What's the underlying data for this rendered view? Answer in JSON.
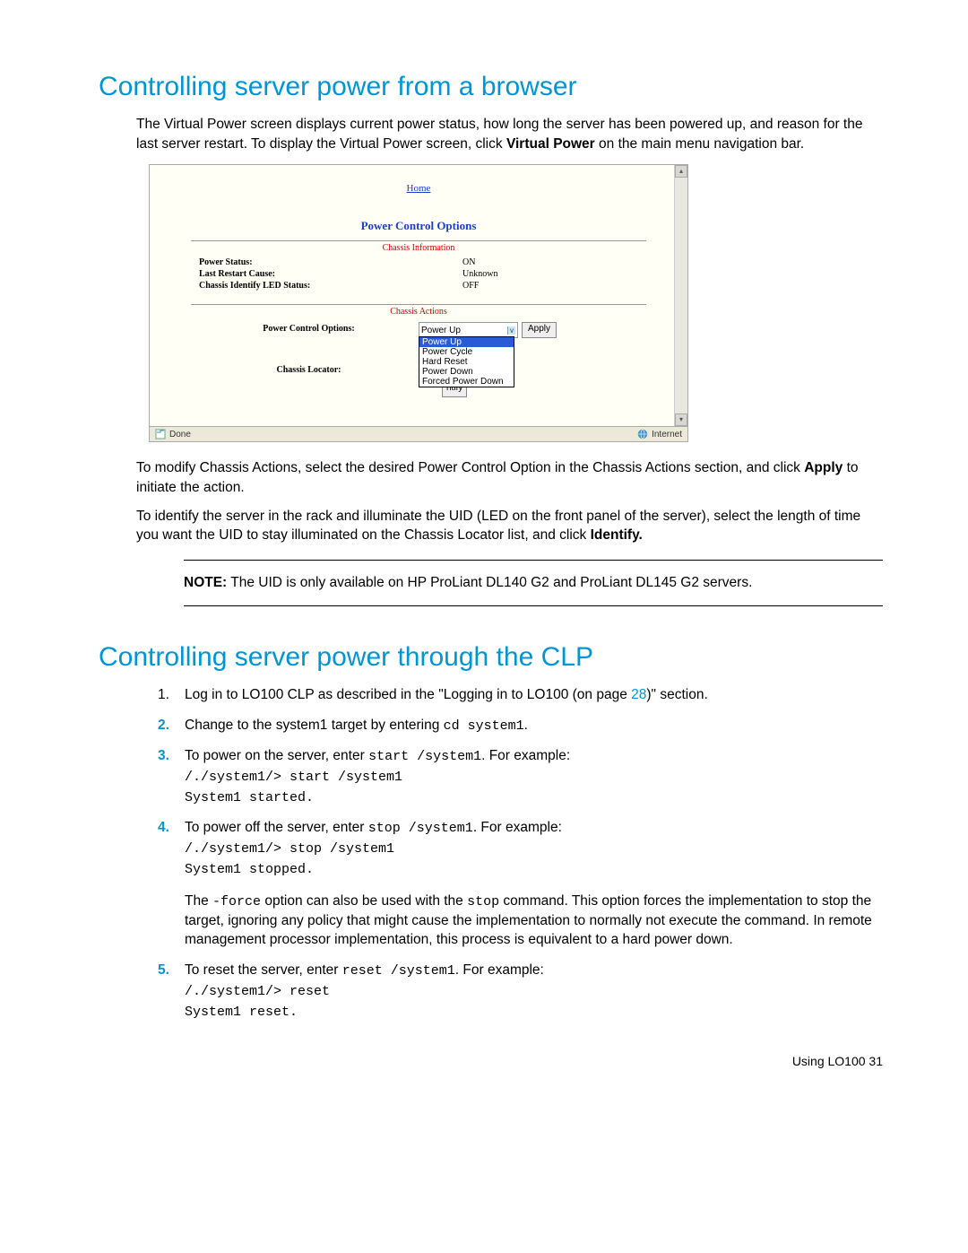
{
  "section1": {
    "title": "Controlling server power from a browser",
    "para1_pre": "The Virtual Power screen displays current power status, how long the server has been powered up, and reason for the last server restart. To display the Virtual Power screen, click ",
    "para1_bold": "Virtual Power",
    "para1_post": " on the main menu navigation bar.",
    "para2_pre": "To modify Chassis Actions, select the desired Power Control Option in the Chassis Actions section, and click ",
    "para2_bold": "Apply",
    "para2_post": " to initiate the action.",
    "para3_pre": "To identify the server in the rack and illuminate the UID (LED on the front panel of the server), select the length of time you want the UID to stay illuminated on the Chassis Locator list, and click ",
    "para3_bold": "Identify.",
    "note_label": "NOTE:",
    "note_text": "  The UID is only available on HP ProLiant DL140 G2 and ProLiant DL145 G2 servers."
  },
  "screenshot": {
    "home_link": "Home",
    "pco_title": "Power Control Options",
    "chassis_info_label": "Chassis Information",
    "info": {
      "r1l": "Power Status:",
      "r1r": "ON",
      "r2l": "Last Restart Cause:",
      "r2r": "Unknown",
      "r3l": "Chassis Identify LED Status:",
      "r3r": "OFF"
    },
    "chassis_actions_label": "Chassis Actions",
    "pco_label": "Power Control Options:",
    "pco_selected": "Power Up",
    "apply_btn": "Apply",
    "dropdown": {
      "opt1": "Power Up",
      "opt2": "Power Cycle",
      "opt3": "Hard Reset",
      "opt4": "Power Down",
      "opt5": "Forced Power Down"
    },
    "locator_label": "Chassis Locator:",
    "identify_btn": "ntify",
    "status_done": "Done",
    "status_internet": "Internet"
  },
  "section2": {
    "title": "Controlling server power through the CLP",
    "step1_pre": "Log in to LO100 CLP as described in the \"Logging in to LO100 (on page ",
    "step1_page": "28",
    "step1_post": ")\" section.",
    "step2_pre": "Change to the system1 target by entering ",
    "step2_code": "cd system1",
    "step2_post": ".",
    "step3_pre": "To power on the server, enter ",
    "step3_code": "start /system1",
    "step3_post": ". For example:",
    "step3_line1": "/./system1/> start /system1",
    "step3_line2": "System1 started.",
    "step4_pre": "To power off the server, enter ",
    "step4_code": "stop /system1",
    "step4_post": ". For example:",
    "step4_line1": "/./system1/> stop /system1",
    "step4_line2": "System1 stopped.",
    "step4_para_pre": "The ",
    "step4_para_code1": "-force",
    "step4_para_mid": " option can also be used with the ",
    "step4_para_code2": "stop",
    "step4_para_post": " command. This option forces the implementation to stop the target, ignoring any policy that might cause the implementation to normally not execute the command. In remote management processor implementation, this process is equivalent to a hard power down.",
    "step5_pre": "To reset the server, enter ",
    "step5_code": "reset /system1",
    "step5_post": ". For example:",
    "step5_line1": "/./system1/> reset",
    "step5_line2": "System1 reset."
  },
  "footer": {
    "text": "Using LO100   31"
  }
}
